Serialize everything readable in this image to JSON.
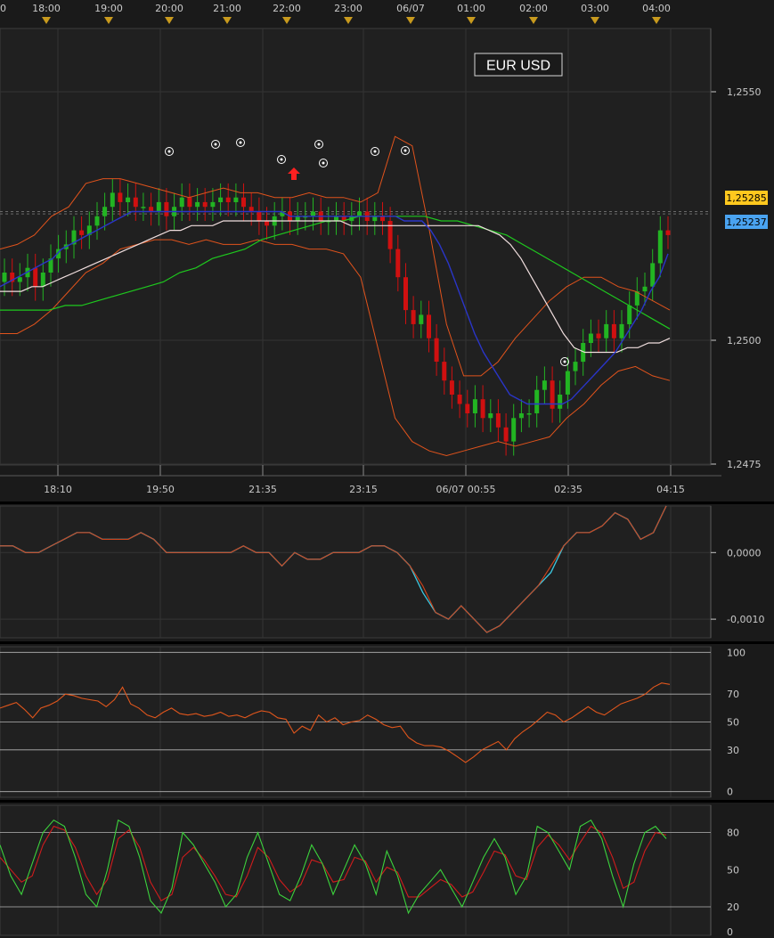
{
  "instrument": "EUR USD",
  "colors": {
    "background": "#1a1a1a",
    "panel": "#202020",
    "grid": "#343434",
    "axis_text": "#c8c8c8",
    "candle_up": "#22b422",
    "candle_down": "#d01010",
    "bollinger": "#e0531c",
    "ma_blue": "#2a35c8",
    "ma_white": "#f0dede",
    "ma_green": "#1ec81e",
    "macd_a": "#3cc8e0",
    "macd_b": "#d0441c",
    "rsi": "#e0561c",
    "stoch_k": "#3cd23c",
    "stoch_d": "#d01c1c",
    "badge_yellow": "#ffc81e",
    "badge_blue": "#4aa3f0",
    "marker_triangle": "#c89a1e",
    "arrow": "#ff2020"
  },
  "top_time_axis": [
    "0",
    "18:00",
    "19:00",
    "20:00",
    "21:00",
    "22:00",
    "23:00",
    "06/07",
    "01:00",
    "02:00",
    "03:00",
    "04:00"
  ],
  "bottom_time_axis": [
    "18:10",
    "19:50",
    "21:35",
    "23:15",
    "06/07 00:55",
    "02:35",
    "04:15"
  ],
  "price_axis": [
    "1,2550",
    "1,2500",
    "1,2475"
  ],
  "price_badges": {
    "yellow": "1,25285",
    "blue": "1,25237"
  },
  "macd_axis": [
    "0,0000",
    "-0,0010"
  ],
  "rsi_axis": [
    "100",
    "70",
    "50",
    "30",
    "0"
  ],
  "stoch_axis": [
    "80",
    "50",
    "20",
    "0"
  ],
  "chart_data": [
    {
      "type": "candlestick",
      "title": "EUR USD",
      "ylim": [
        1.2475,
        1.2568
      ],
      "y_ticks": [
        1.2475,
        1.25,
        1.255
      ],
      "reference_lines": [
        1.2529,
        1.25285
      ],
      "close": [
        1.2516,
        1.2514,
        1.2515,
        1.2517,
        1.2513,
        1.2516,
        1.2519,
        1.2521,
        1.2522,
        1.2525,
        1.2524,
        1.2526,
        1.2528,
        1.253,
        1.2533,
        1.2531,
        1.2532,
        1.253,
        1.253,
        1.2529,
        1.2531,
        1.2528,
        1.253,
        1.2532,
        1.253,
        1.2531,
        1.253,
        1.2531,
        1.2532,
        1.2531,
        1.2532,
        1.253,
        1.2529,
        1.2527,
        1.2526,
        1.2528,
        1.2529,
        1.2527,
        1.2528,
        1.2528,
        1.2529,
        1.2527,
        1.2527,
        1.2528,
        1.2527,
        1.2528,
        1.2529,
        1.2527,
        1.2528,
        1.2527,
        1.2521,
        1.2515,
        1.2508,
        1.2505,
        1.2507,
        1.2502,
        1.2497,
        1.2493,
        1.249,
        1.2488,
        1.2486,
        1.2489,
        1.2485,
        1.2486,
        1.2483,
        1.248,
        1.2485,
        1.2486,
        1.2486,
        1.2491,
        1.2493,
        1.2487,
        1.249,
        1.2495,
        1.2497,
        1.2501,
        1.2503,
        1.2502,
        1.2505,
        1.2502,
        1.2505,
        1.2509,
        1.2512,
        1.2513,
        1.2518,
        1.2525,
        1.2524
      ],
      "ma_blue": [
        1.2513,
        1.2514,
        1.2515,
        1.2516,
        1.2517,
        1.2518,
        1.2519,
        1.2521,
        1.2522,
        1.2523,
        1.2524,
        1.2525,
        1.2526,
        1.2527,
        1.2528,
        1.2529,
        1.2529,
        1.2529,
        1.2529,
        1.2529,
        1.2529,
        1.2529,
        1.2529,
        1.2529,
        1.2529,
        1.2529,
        1.2529,
        1.2529,
        1.2529,
        1.2529,
        1.2529,
        1.2529,
        1.2529,
        1.2528,
        1.2528,
        1.2528,
        1.2528,
        1.2528,
        1.2528,
        1.2528,
        1.2528,
        1.2528,
        1.2528,
        1.2528,
        1.2528,
        1.2528,
        1.2527,
        1.2527,
        1.2527,
        1.2525,
        1.2522,
        1.2518,
        1.2513,
        1.2508,
        1.2503,
        1.2499,
        1.2496,
        1.2493,
        1.249,
        1.2489,
        1.2488,
        1.2488,
        1.2488,
        1.2488,
        1.2488,
        1.2489,
        1.2491,
        1.2493,
        1.2495,
        1.2497,
        1.2499,
        1.2502,
        1.2505,
        1.2508,
        1.2512,
        1.2515,
        1.252
      ],
      "ma_white": [
        1.2512,
        1.2512,
        1.2512,
        1.2513,
        1.2513,
        1.2514,
        1.2515,
        1.2516,
        1.2517,
        1.2518,
        1.2519,
        1.252,
        1.2521,
        1.2522,
        1.2523,
        1.2524,
        1.2525,
        1.2525,
        1.2526,
        1.2526,
        1.2526,
        1.2527,
        1.2527,
        1.2527,
        1.2527,
        1.2527,
        1.2527,
        1.2527,
        1.2527,
        1.2527,
        1.2527,
        1.2527,
        1.2527,
        1.2526,
        1.2526,
        1.2526,
        1.2526,
        1.2526,
        1.2526,
        1.2526,
        1.2526,
        1.2526,
        1.2526,
        1.2526,
        1.2526,
        1.2526,
        1.2525,
        1.2524,
        1.2522,
        1.2519,
        1.2515,
        1.2511,
        1.2507,
        1.2503,
        1.25,
        1.2499,
        1.2499,
        1.2499,
        1.2499,
        1.25,
        1.25,
        1.2501,
        1.2501,
        1.2502
      ],
      "ma_green": [
        1.2508,
        1.2508,
        1.2508,
        1.2508,
        1.2509,
        1.2509,
        1.251,
        1.2511,
        1.2512,
        1.2513,
        1.2514,
        1.2516,
        1.2517,
        1.2519,
        1.252,
        1.2521,
        1.2523,
        1.2524,
        1.2525,
        1.2526,
        1.2527,
        1.2527,
        1.2528,
        1.2528,
        1.2528,
        1.2528,
        1.2528,
        1.2527,
        1.2527,
        1.2526,
        1.2525,
        1.2524,
        1.2522,
        1.252,
        1.2518,
        1.2516,
        1.2514,
        1.2512,
        1.251,
        1.2508,
        1.2506,
        1.2504
      ],
      "bollinger_upper": [
        1.2521,
        1.2522,
        1.2524,
        1.2528,
        1.253,
        1.2535,
        1.2536,
        1.2536,
        1.2535,
        1.2534,
        1.2533,
        1.2532,
        1.2533,
        1.2534,
        1.2533,
        1.2533,
        1.2532,
        1.2532,
        1.2533,
        1.2532,
        1.2532,
        1.2531,
        1.2533,
        1.2545,
        1.2543,
        1.2525,
        1.2505,
        1.2494,
        1.2494,
        1.2497,
        1.2502,
        1.2506,
        1.251,
        1.2513,
        1.2515,
        1.2515,
        1.2513,
        1.2512,
        1.251,
        1.2508
      ],
      "bollinger_lower": [
        1.2503,
        1.2503,
        1.2505,
        1.2508,
        1.2512,
        1.2516,
        1.2518,
        1.2521,
        1.2522,
        1.2523,
        1.2523,
        1.2522,
        1.2523,
        1.2522,
        1.2522,
        1.2523,
        1.2522,
        1.2522,
        1.2521,
        1.2521,
        1.252,
        1.2515,
        1.25,
        1.2485,
        1.248,
        1.2478,
        1.2477,
        1.2478,
        1.2479,
        1.248,
        1.2479,
        1.248,
        1.2481,
        1.2485,
        1.2488,
        1.2492,
        1.2495,
        1.2496,
        1.2494,
        1.2493
      ]
    },
    {
      "type": "line",
      "title": "",
      "ylim": [
        -0.00128,
        0.0007
      ],
      "y_ticks": [
        0.0,
        -0.001
      ],
      "series": [
        {
          "values": [
            0.0001,
            0.0001,
            0.0,
            0.0,
            0.0001,
            0.0002,
            0.0003,
            0.0003,
            0.0002,
            0.0002,
            0.0002,
            0.0003,
            0.0002,
            0.0,
            0.0,
            0.0,
            0.0,
            0.0,
            0.0,
            0.0001,
            0.0,
            0.0,
            -0.0002,
            0.0,
            -0.0001,
            -0.0001,
            0.0,
            0.0,
            0.0,
            0.0001,
            0.0001,
            0.0,
            -0.0002,
            -0.0006,
            -0.0009,
            -0.001,
            -0.0008,
            -0.001,
            -0.0012,
            -0.0011,
            -0.0009,
            -0.0007,
            -0.0005,
            -0.0003,
            0.0001,
            0.0003,
            0.0003,
            0.0004,
            0.0006,
            0.0005,
            0.0002,
            0.0003,
            0.0007
          ]
        },
        {
          "values": [
            0.0001,
            0.0001,
            0.0,
            0.0,
            0.0001,
            0.0002,
            0.0003,
            0.0003,
            0.0002,
            0.0002,
            0.0002,
            0.0003,
            0.0002,
            0.0,
            0.0,
            0.0,
            0.0,
            0.0,
            0.0,
            0.0001,
            0.0,
            0.0,
            -0.0002,
            0.0,
            -0.0001,
            -0.0001,
            0.0,
            0.0,
            0.0,
            0.0001,
            0.0001,
            0.0,
            -0.0002,
            -0.0005,
            -0.0009,
            -0.001,
            -0.0008,
            -0.001,
            -0.0012,
            -0.0011,
            -0.0009,
            -0.0007,
            -0.0005,
            -0.0002,
            0.0001,
            0.0003,
            0.0003,
            0.0004,
            0.0006,
            0.0005,
            0.0002,
            0.0003,
            0.0007
          ]
        }
      ]
    },
    {
      "type": "line",
      "title": "",
      "ylim": [
        0,
        100
      ],
      "y_ticks": [
        100,
        70,
        50,
        30,
        0
      ],
      "series": [
        {
          "values": [
            60,
            62,
            64,
            59,
            53,
            60,
            62,
            65,
            70,
            69,
            67,
            66,
            65,
            61,
            66,
            75,
            63,
            60,
            55,
            53,
            57,
            60,
            56,
            55,
            56,
            54,
            55,
            57,
            54,
            55,
            53,
            56,
            58,
            57,
            53,
            52,
            42,
            47,
            44,
            55,
            50,
            53,
            48,
            50,
            51,
            55,
            52,
            48,
            46,
            47,
            39,
            35,
            33,
            33,
            32,
            29,
            25,
            21,
            25,
            30,
            33,
            36,
            30,
            38,
            43,
            47,
            52,
            57,
            55,
            50,
            53,
            57,
            61,
            57,
            55,
            59,
            63,
            65,
            67,
            70,
            75,
            78,
            77
          ]
        }
      ]
    },
    {
      "type": "line",
      "title": "",
      "ylim": [
        0,
        100
      ],
      "y_ticks": [
        80,
        50,
        20,
        0
      ],
      "series": [
        {
          "values": [
            70,
            45,
            30,
            55,
            80,
            90,
            85,
            60,
            30,
            20,
            50,
            90,
            85,
            60,
            25,
            15,
            35,
            80,
            70,
            55,
            40,
            20,
            30,
            60,
            80,
            55,
            30,
            25,
            45,
            70,
            55,
            30,
            50,
            70,
            55,
            30,
            65,
            45,
            15,
            30,
            40,
            50,
            35,
            20,
            40,
            60,
            75,
            60,
            30,
            45,
            85,
            80,
            65,
            50,
            85,
            90,
            75,
            45,
            20,
            55,
            80,
            85,
            75
          ]
        },
        {
          "values": [
            60,
            50,
            40,
            45,
            70,
            85,
            82,
            68,
            45,
            30,
            42,
            75,
            82,
            68,
            40,
            25,
            30,
            60,
            68,
            58,
            45,
            30,
            28,
            45,
            68,
            60,
            42,
            32,
            38,
            58,
            55,
            40,
            42,
            60,
            57,
            40,
            52,
            48,
            28,
            28,
            35,
            42,
            38,
            28,
            32,
            48,
            65,
            62,
            45,
            42,
            68,
            78,
            70,
            58,
            72,
            85,
            80,
            60,
            35,
            40,
            65,
            80,
            78
          ]
        }
      ]
    }
  ]
}
